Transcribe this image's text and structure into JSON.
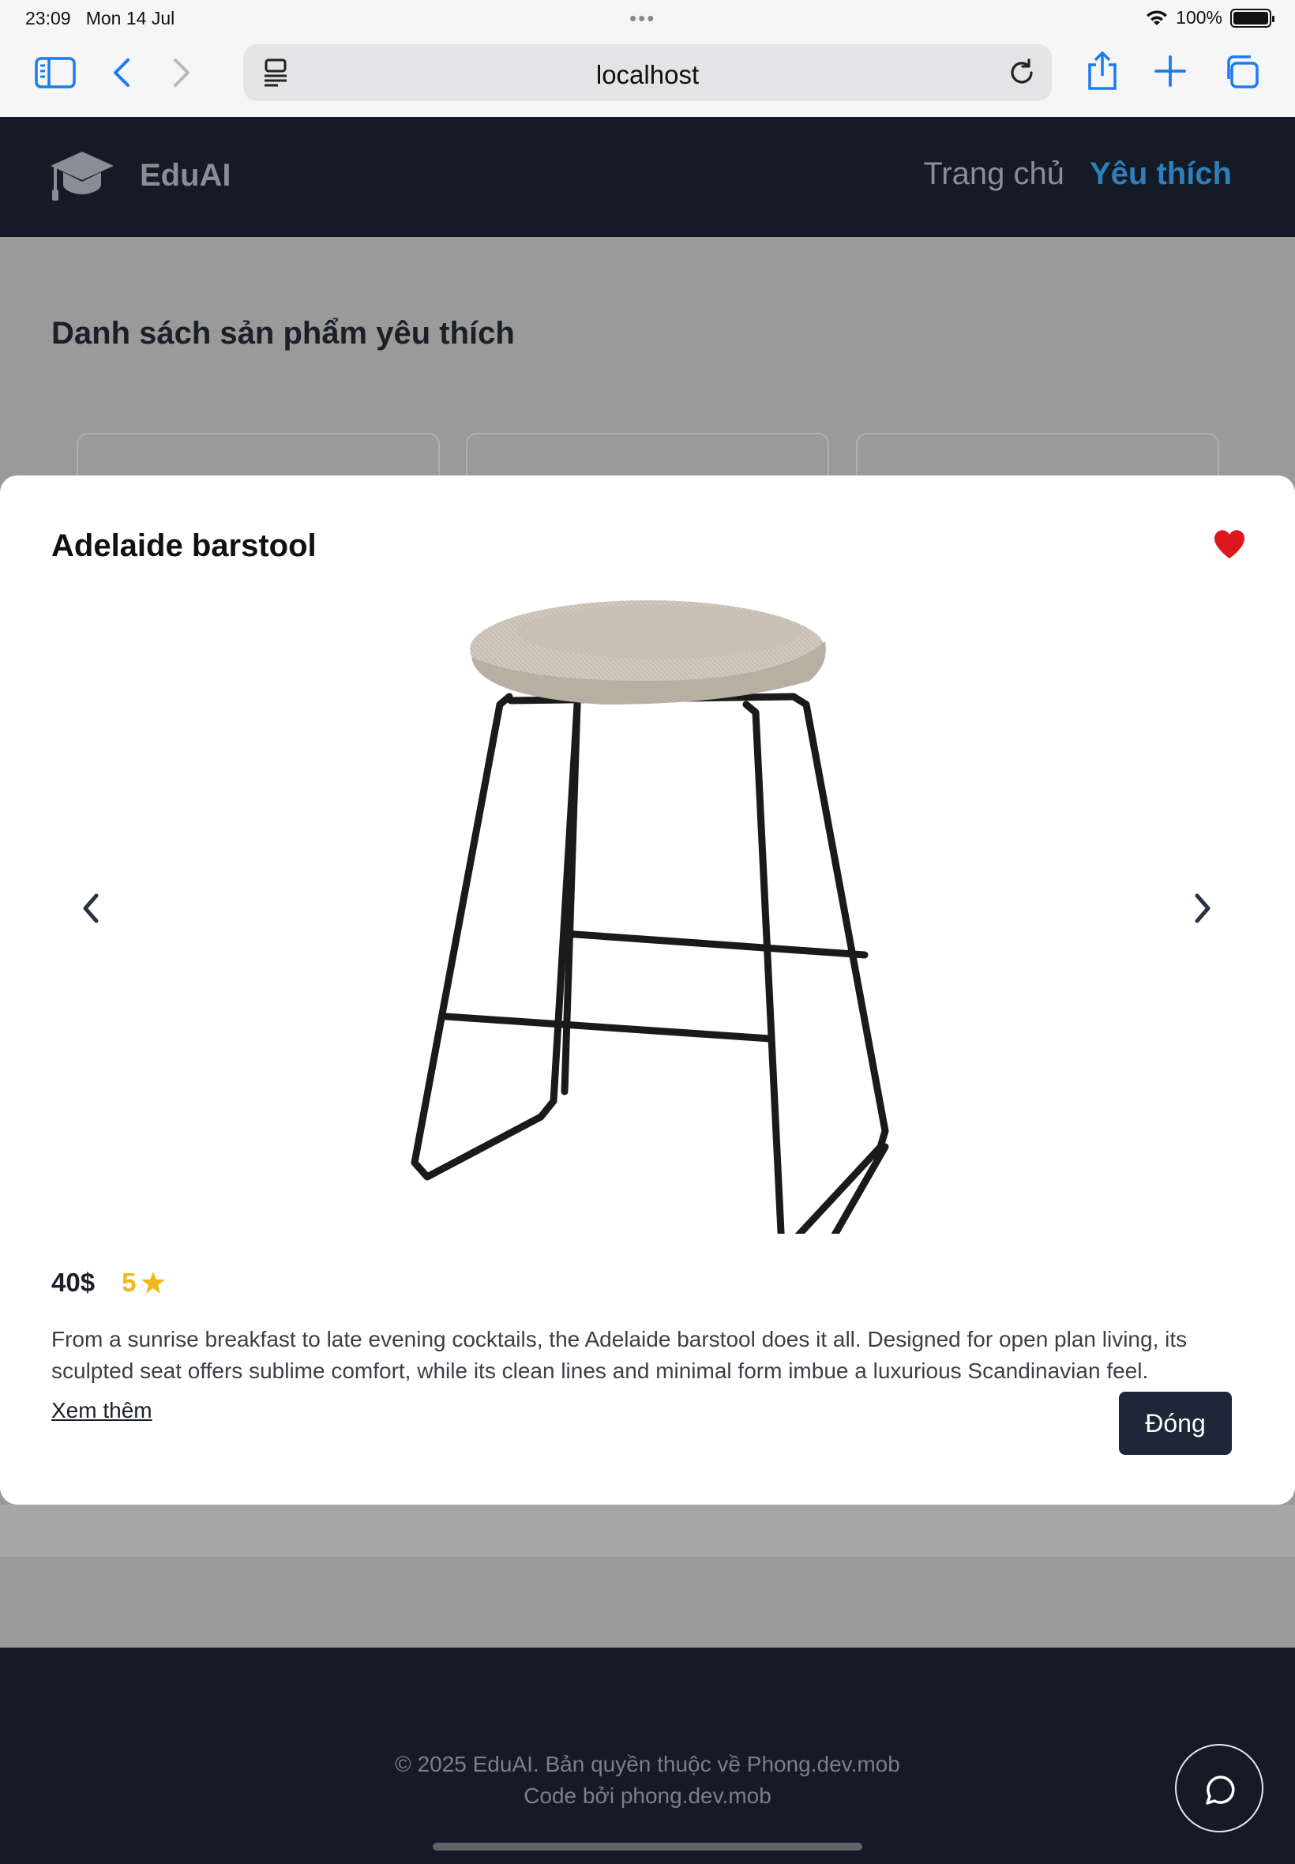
{
  "status": {
    "time": "23:09",
    "date": "Mon 14 Jul",
    "battery": "100%"
  },
  "browser": {
    "url": "localhost"
  },
  "header": {
    "brand": "EduAI",
    "nav_home": "Trang chủ",
    "nav_favorites": "Yêu thích"
  },
  "page": {
    "title": "Danh sách sản phẩm yêu thích"
  },
  "modal": {
    "title": "Adelaide barstool",
    "price": "40$",
    "rating": "5",
    "description": "From a sunrise breakfast to late evening cocktails, the Adelaide barstool does it all. Designed for open plan living, its sculpted seat offers sublime comfort, while its clean lines and minimal form imbue a luxurious Scandinavian feel.",
    "more_label": "Xem thêm",
    "close_label": "Đóng"
  },
  "footer": {
    "copyright": "© 2025 EduAI. Bản quyền thuộc về Phong.dev.mob",
    "credit": "Code bởi phong.dev.mob"
  },
  "colors": {
    "header_bg": "#141a26",
    "accent": "#2f7fb8",
    "heart": "#e0161e",
    "star": "#f3b71c",
    "safari_blue": "#1a7cf0"
  },
  "icons": [
    "sidebar-icon",
    "back-icon",
    "forward-icon",
    "reader-icon",
    "reload-icon",
    "share-icon",
    "new-tab-icon",
    "tabs-icon",
    "graduation-cap-icon",
    "heart-icon",
    "chevron-left-icon",
    "chevron-right-icon",
    "star-icon",
    "chat-icon",
    "wifi-icon",
    "battery-icon"
  ]
}
